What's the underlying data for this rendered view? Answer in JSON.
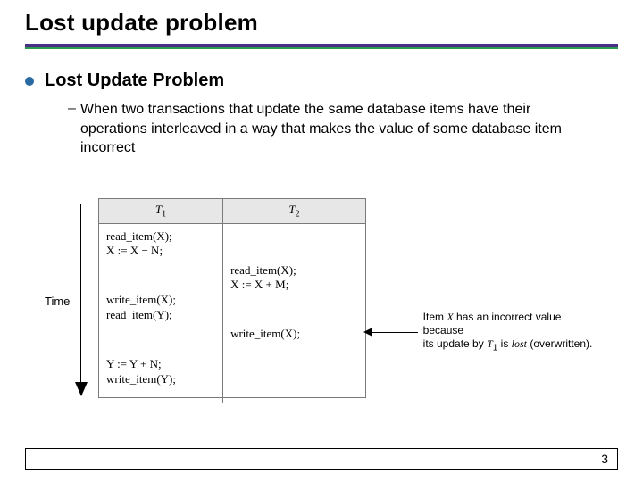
{
  "title": "Lost update problem",
  "bullet_l1": "Lost Update Problem",
  "bullet_l2": "When two transactions that update the same database items have their operations interleaved in a way that makes the value of some database item incorrect",
  "time_label": "Time",
  "table": {
    "headers": {
      "c1_prefix": "T",
      "c1_sub": "1",
      "c2_prefix": "T",
      "c2_sub": "2"
    },
    "t1": {
      "r1": "read_item(X);",
      "r2": "X := X − N;",
      "r3": "write_item(X);",
      "r4": "read_item(Y);",
      "r5": "Y := Y + N;",
      "r6": "write_item(Y);"
    },
    "t2": {
      "r1": "read_item(X);",
      "r2": "X := X + M;",
      "r3": "write_item(X);"
    }
  },
  "annotation": {
    "line1_a": "Item ",
    "line1_b": "X",
    "line1_c": " has an incorrect value because",
    "line2_a": "its update by ",
    "line2_b": "T",
    "line2_sub": "1",
    "line2_c": " is ",
    "line2_d": "lost",
    "line2_e": " (overwritten)."
  },
  "page_number": "3"
}
